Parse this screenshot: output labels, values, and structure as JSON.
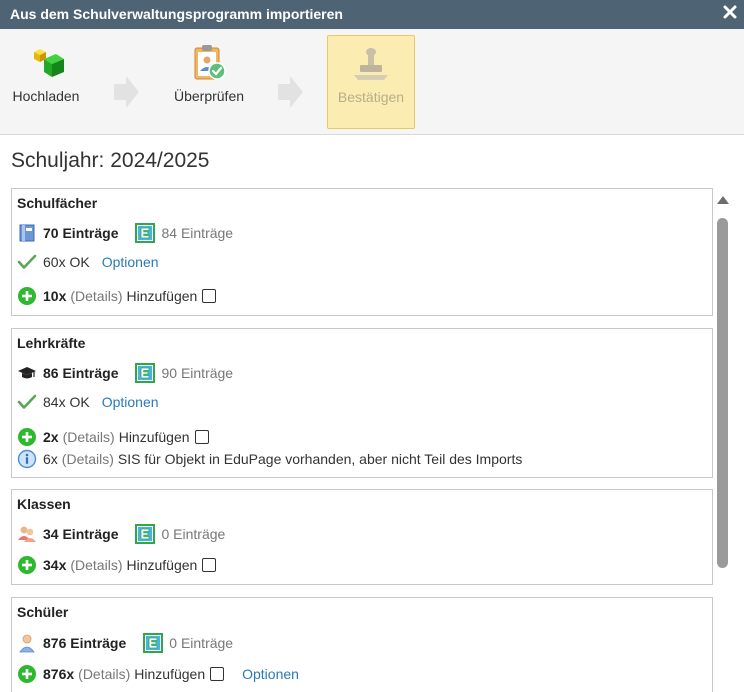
{
  "dialog": {
    "title": "Aus dem Schulverwaltungsprogramm importieren"
  },
  "steps": [
    {
      "label": "Hochladen"
    },
    {
      "label": "Überprüfen"
    },
    {
      "label": "Bestätigen"
    }
  ],
  "school_year": "Schuljahr: 2024/2025",
  "sections": {
    "subjects": {
      "title": "Schulfächer",
      "count": "70 Einträge",
      "edupage_count": "84 Einträge",
      "ok_count": "60x OK",
      "ok_options": "Optionen",
      "add_count": "10x",
      "add_details": "(Details)",
      "add_label": "Hinzufügen"
    },
    "teachers": {
      "title": "Lehrkräfte",
      "count": "86 Einträge",
      "edupage_count": "90 Einträge",
      "ok_count": "84x OK",
      "ok_options": "Optionen",
      "add_count": "2x",
      "add_details": "(Details)",
      "add_label": "Hinzufügen",
      "info_count": "6x",
      "info_details": "(Details)",
      "info_text": "SIS für Objekt in EduPage vorhanden, aber nicht Teil des Imports"
    },
    "classes": {
      "title": "Klassen",
      "count": "34 Einträge",
      "edupage_count": "0 Einträge",
      "add_count": "34x",
      "add_details": "(Details)",
      "add_label": "Hinzufügen"
    },
    "students": {
      "title": "Schüler",
      "count": "876 Einträge",
      "edupage_count": "0 Einträge",
      "add_count": "876x",
      "add_details": "(Details)",
      "add_label": "Hinzufügen",
      "add_options": "Optionen"
    }
  },
  "colors": {
    "titlebar": "#4e6474",
    "active_step": "#fbedb2",
    "link": "#2a7ab8",
    "ok_green": "#4caf50",
    "add_green": "#2eb82e",
    "info_blue": "#4a90d9"
  }
}
